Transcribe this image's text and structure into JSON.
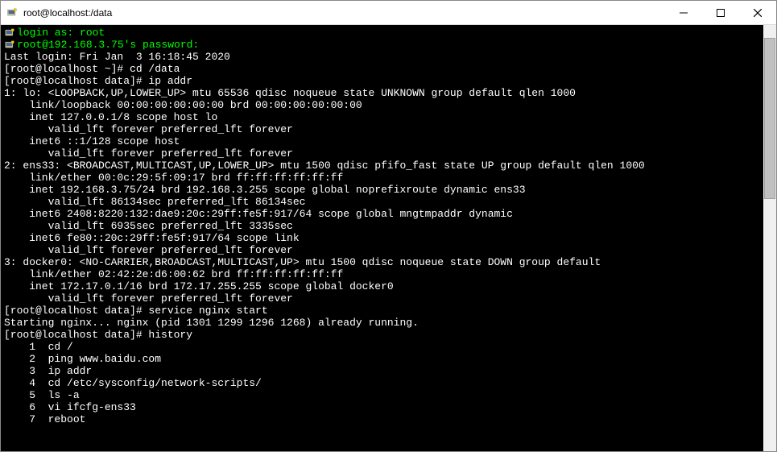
{
  "window": {
    "title": "root@localhost:/data"
  },
  "terminal": {
    "lines": [
      "login as: root",
      "root@192.168.3.75's password:",
      "Last login: Fri Jan  3 16:18:45 2020",
      "[root@localhost ~]# cd /data",
      "[root@localhost data]# ip addr",
      "1: lo: <LOOPBACK,UP,LOWER_UP> mtu 65536 qdisc noqueue state UNKNOWN group default qlen 1000",
      "    link/loopback 00:00:00:00:00:00 brd 00:00:00:00:00:00",
      "    inet 127.0.0.1/8 scope host lo",
      "       valid_lft forever preferred_lft forever",
      "    inet6 ::1/128 scope host",
      "       valid_lft forever preferred_lft forever",
      "2: ens33: <BROADCAST,MULTICAST,UP,LOWER_UP> mtu 1500 qdisc pfifo_fast state UP group default qlen 1000",
      "    link/ether 00:0c:29:5f:09:17 brd ff:ff:ff:ff:ff:ff",
      "    inet 192.168.3.75/24 brd 192.168.3.255 scope global noprefixroute dynamic ens33",
      "       valid_lft 86134sec preferred_lft 86134sec",
      "    inet6 2408:8220:132:dae9:20c:29ff:fe5f:917/64 scope global mngtmpaddr dynamic",
      "       valid_lft 6935sec preferred_lft 3335sec",
      "    inet6 fe80::20c:29ff:fe5f:917/64 scope link",
      "       valid_lft forever preferred_lft forever",
      "3: docker0: <NO-CARRIER,BROADCAST,MULTICAST,UP> mtu 1500 qdisc noqueue state DOWN group default",
      "    link/ether 02:42:2e:d6:00:62 brd ff:ff:ff:ff:ff:ff",
      "    inet 172.17.0.1/16 brd 172.17.255.255 scope global docker0",
      "       valid_lft forever preferred_lft forever",
      "[root@localhost data]# service nginx start",
      "Starting nginx... nginx (pid 1301 1299 1296 1268) already running.",
      "[root@localhost data]# history",
      "    1  cd /",
      "    2  ping www.baidu.com",
      "    3  ip addr",
      "    4  cd /etc/sysconfig/network-scripts/",
      "    5  ls -a",
      "    6  vi ifcfg-ens33",
      "    7  reboot"
    ],
    "login_prompt_lines": [
      0,
      1
    ]
  }
}
